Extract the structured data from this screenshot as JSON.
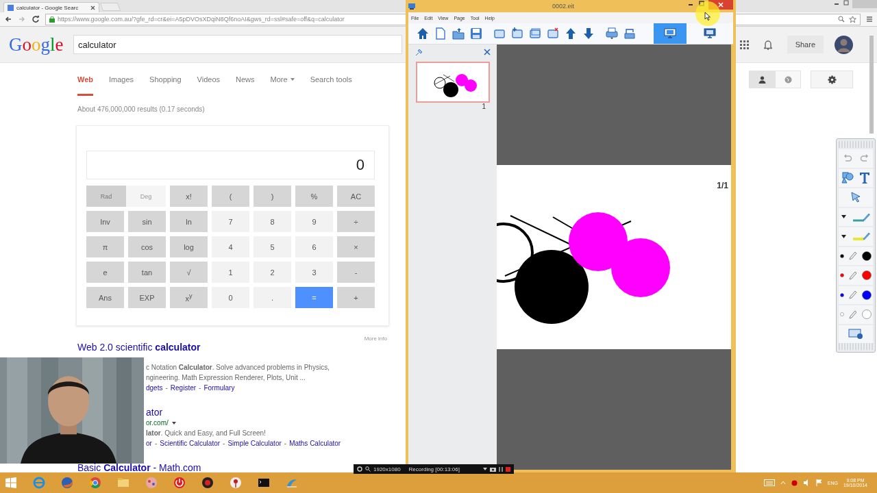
{
  "browser": {
    "tab_title": "calculator - Google Searc",
    "url": "https://www.google.com.au/?gfe_rd=cr&ei=A5pDVOsXDqiN8Qf6noAI&gws_rd=ssl#safe=off&q=calculator"
  },
  "google": {
    "logo": "Google",
    "query": "calculator",
    "share": "Share",
    "tabs": [
      {
        "label": "Web",
        "selected": true
      },
      {
        "label": "Images",
        "selected": false
      },
      {
        "label": "Shopping",
        "selected": false
      },
      {
        "label": "Videos",
        "selected": false
      },
      {
        "label": "News",
        "selected": false
      },
      {
        "label": "More",
        "selected": false,
        "kind": "menu"
      },
      {
        "label": "Search tools",
        "selected": false
      }
    ],
    "account_toggle": [
      {
        "selected": true
      },
      {
        "selected": false
      }
    ],
    "stats": "About 476,000,000 results (0.17 seconds)"
  },
  "calculator": {
    "display": "0",
    "more_info": "More info",
    "keys": [
      {
        "kind": "toggle",
        "options": [
          {
            "label": "Rad",
            "selected": true
          },
          {
            "label": "Deg",
            "selected": false
          }
        ]
      },
      {
        "label": "x!",
        "kind": "fn"
      },
      {
        "label": "(",
        "kind": "fn"
      },
      {
        "label": ")",
        "kind": "fn"
      },
      {
        "label": "%",
        "kind": "fn"
      },
      {
        "label": "AC",
        "kind": "fn"
      },
      {
        "label": "Inv",
        "kind": "fn"
      },
      {
        "label": "sin",
        "kind": "fn"
      },
      {
        "label": "ln",
        "kind": "fn"
      },
      {
        "label": "7",
        "kind": "num"
      },
      {
        "label": "8",
        "kind": "num"
      },
      {
        "label": "9",
        "kind": "num"
      },
      {
        "label": "÷",
        "kind": "fn"
      },
      {
        "label": "π",
        "kind": "fn"
      },
      {
        "label": "cos",
        "kind": "fn"
      },
      {
        "label": "log",
        "kind": "fn"
      },
      {
        "label": "4",
        "kind": "num"
      },
      {
        "label": "5",
        "kind": "num"
      },
      {
        "label": "6",
        "kind": "num"
      },
      {
        "label": "×",
        "kind": "fn"
      },
      {
        "label": "e",
        "kind": "fn"
      },
      {
        "label": "tan",
        "kind": "fn"
      },
      {
        "label": "√",
        "kind": "fn"
      },
      {
        "label": "1",
        "kind": "num"
      },
      {
        "label": "2",
        "kind": "num"
      },
      {
        "label": "3",
        "kind": "num"
      },
      {
        "label": "-",
        "kind": "fn"
      },
      {
        "label": "Ans",
        "kind": "fn"
      },
      {
        "label": "EXP",
        "kind": "fn"
      },
      {
        "label": "x$^{y}$",
        "kind": "fn"
      },
      {
        "label": "0",
        "kind": "num"
      },
      {
        "label": ".",
        "kind": "num"
      },
      {
        "label": "=",
        "kind": "equals"
      },
      {
        "label": "+",
        "kind": "fn"
      }
    ]
  },
  "results": [
    {
      "title": "Web 2.0 scientific **calculator**",
      "lines": [
        {
          "kind": "snippet",
          "text": "c Notation **Calculator**. Solve advanced problems in Physics,"
        },
        {
          "kind": "snippet",
          "text": "ngineering. Math Expression Renderer, Plots, Unit ..."
        },
        {
          "kind": "links",
          "links": [
            {
              "kind": "link",
              "text": "dgets"
            },
            {
              "kind": "sep",
              "text": "-"
            },
            {
              "kind": "link",
              "text": "Register"
            },
            {
              "kind": "sep",
              "text": "-"
            },
            {
              "kind": "link",
              "text": "Formulary"
            }
          ]
        }
      ]
    },
    {
      "title": "ator",
      "lines": [
        {
          "kind": "url",
          "text": "or.com/"
        },
        {
          "kind": "snippet",
          "text": "**lator**. Quick and Easy, and Full Screen!"
        },
        {
          "kind": "links",
          "links": [
            {
              "kind": "link",
              "text": "or"
            },
            {
              "kind": "sep",
              "text": "-"
            },
            {
              "kind": "link",
              "text": "Scientific Calculator"
            },
            {
              "kind": "sep",
              "text": "-"
            },
            {
              "kind": "link",
              "text": "Simple Calculator"
            },
            {
              "kind": "sep",
              "text": "-"
            },
            {
              "kind": "link",
              "text": "Maths Calculator"
            }
          ]
        }
      ]
    },
    {
      "title": "Basic **Calculator** - Math.com"
    }
  ],
  "whiteboard": {
    "title": "0002.eit",
    "menu": [
      "File",
      "Edit",
      "View",
      "Page",
      "Tool",
      "Help"
    ],
    "view_buttons": [
      {
        "selected": true
      },
      {
        "selected": false
      }
    ],
    "thumbnails": [
      {
        "number": "1",
        "selected": true
      }
    ],
    "page_indicator": "1/1"
  },
  "pen_colors": [
    {
      "color": "#000000"
    },
    {
      "color": "#ff0000"
    },
    {
      "color": "#0000ff"
    },
    {
      "color": "#ffffff"
    }
  ],
  "recorder": {
    "resolution": "1920x1080",
    "status": "Recording [00:13:06]"
  },
  "taskbar": {
    "language": "ENG",
    "time": "9:08 PM",
    "date": "19/10/2014"
  }
}
